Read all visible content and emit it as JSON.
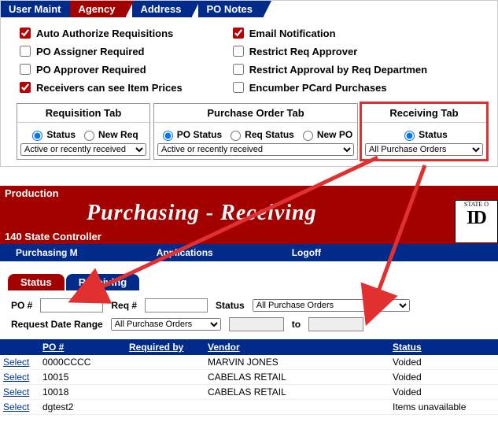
{
  "topTabs": [
    "User Maint",
    "Agency",
    "Address",
    "PO Notes"
  ],
  "options": {
    "left": [
      {
        "label": "Auto Authorize Requisitions",
        "checked": true
      },
      {
        "label": "PO Assigner Required",
        "checked": false
      },
      {
        "label": "PO Approver Required",
        "checked": false
      },
      {
        "label": "Receivers can see Item Prices",
        "checked": true
      }
    ],
    "right": [
      {
        "label": "Email Notification",
        "checked": true
      },
      {
        "label": "Restrict Req Approver",
        "checked": false
      },
      {
        "label": "Restrict Approval by Req Departmen",
        "checked": false
      },
      {
        "label": "Encumber PCard Purchases",
        "checked": false
      }
    ]
  },
  "subTabs": {
    "req": {
      "title": "Requisition Tab",
      "radios": [
        {
          "label": "Status",
          "checked": true
        },
        {
          "label": "New Req",
          "checked": false
        }
      ],
      "select": "Active or recently received"
    },
    "po": {
      "title": "Purchase Order Tab",
      "radios": [
        {
          "label": "PO Status",
          "checked": true
        },
        {
          "label": "Req Status",
          "checked": false
        },
        {
          "label": "New PO",
          "checked": false
        }
      ],
      "select": "Active or recently received"
    },
    "recv": {
      "title": "Receiving Tab",
      "radios": [
        {
          "label": "Status",
          "checked": true
        }
      ],
      "select": "All Purchase Orders"
    }
  },
  "lower": {
    "prod": "Production",
    "title": "Purchasing - Receiving",
    "controller": "140 State Controller",
    "menu": [
      "Purchasing M",
      "Applications",
      "Logoff"
    ],
    "logo": {
      "top": "STATE O",
      "big": "ID"
    }
  },
  "bottomTabs": [
    "Status",
    "Receiving"
  ],
  "filters": {
    "poLabel": "PO #",
    "reqLabel": "Req #",
    "statusLabel": "Status",
    "statusValue": "All Purchase Orders",
    "dateLabel": "Request Date Range",
    "dateSelect": "All Purchase Orders",
    "toLabel": "to"
  },
  "grid": {
    "headers": {
      "po": "PO #",
      "req": "Required by",
      "vendor": "Vendor",
      "status": "Status"
    },
    "selectLabel": "Select",
    "rows": [
      {
        "po": "0000CCCC",
        "req": "",
        "vendor": "MARVIN JONES",
        "status": "Voided"
      },
      {
        "po": "10015",
        "req": "",
        "vendor": "CABELAS RETAIL",
        "status": "Voided"
      },
      {
        "po": "10018",
        "req": "",
        "vendor": "CABELAS RETAIL",
        "status": "Voided"
      },
      {
        "po": "dgtest2",
        "req": "",
        "vendor": "",
        "status": "Items unavailable"
      }
    ]
  }
}
